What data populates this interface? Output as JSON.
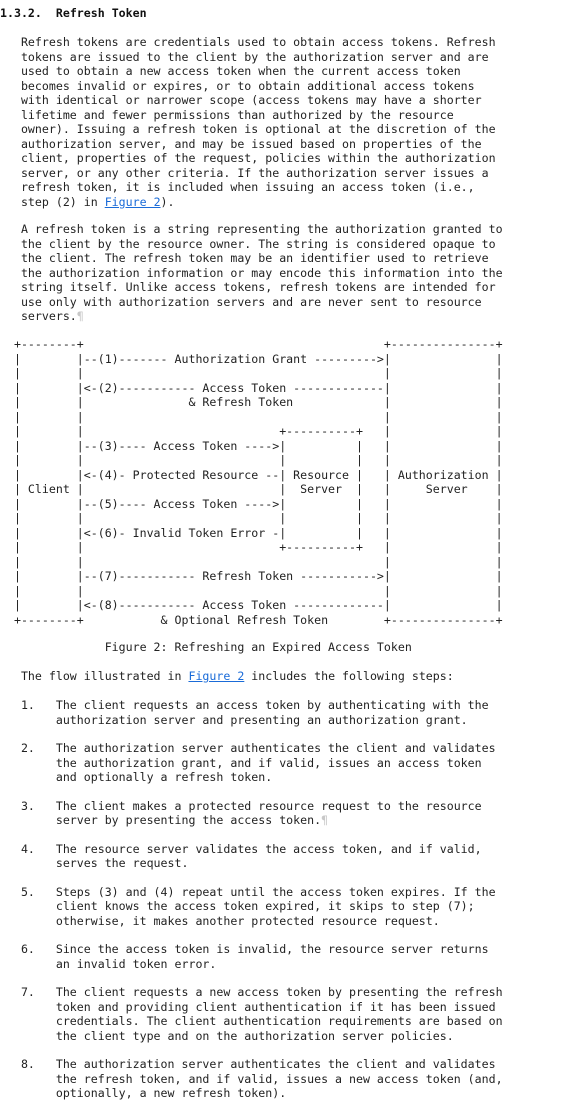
{
  "section": {
    "number": "1.3.2.",
    "title": "Refresh Token"
  },
  "colors": {
    "link": "#1a6bd8",
    "text": "#222222",
    "pilcrow": "#c8c8c8"
  },
  "para1": {
    "l1": "   Refresh tokens are credentials used to obtain access tokens. Refresh",
    "l2": "   tokens are issued to the client by the authorization server and are",
    "l3": "   used to obtain a new access token when the current access token",
    "l4": "   becomes invalid or expires, or to obtain additional access tokens",
    "l5": "   with identical or narrower scope (access tokens may have a shorter",
    "l6": "   lifetime and fewer permissions than authorized by the resource",
    "l7": "   owner). Issuing a refresh token is optional at the discretion of the",
    "l8": "   authorization server, and may be issued based on properties of the",
    "l9": "   client, properties of the request, policies within the authorization",
    "l10": "   server, or any other criteria. If the authorization server issues a",
    "l11": "   refresh token, it is included when issuing an access token (i.e.,",
    "l12_pre": "   step (2) in ",
    "l12_link": "Figure 2",
    "l12_post": ")."
  },
  "para2": {
    "l1": "   A refresh token is a string representing the authorization granted to",
    "l2": "   the client by the resource owner. The string is considered opaque to",
    "l3": "   the client. The refresh token may be an identifier used to retrieve",
    "l4": "   the authorization information or may encode this information into the",
    "l5": "   string itself. Unlike access tokens, refresh tokens are intended for",
    "l6": "   use only with authorization servers and are never sent to resource",
    "l7": "   servers.",
    "pilcrow": "¶"
  },
  "figure": {
    "lines": [
      "  +--------+                                           +---------------+",
      "  |        |--(1)------- Authorization Grant --------->|               |",
      "  |        |                                           |               |",
      "  |        |<-(2)----------- Access Token -------------|               |",
      "  |        |               & Refresh Token             |               |",
      "  |        |                                           |               |",
      "  |        |                            +----------+   |               |",
      "  |        |--(3)---- Access Token ---->|          |   |               |",
      "  |        |                            |          |   |               |",
      "  |        |<-(4)- Protected Resource --| Resource |   | Authorization |",
      "  | Client |                            |  Server  |   |     Server    |",
      "  |        |--(5)---- Access Token ---->|          |   |               |",
      "  |        |                            |          |   |               |",
      "  |        |<-(6)- Invalid Token Error -|          |   |               |",
      "  |        |                            +----------+   |               |",
      "  |        |                                           |               |",
      "  |        |--(7)----------- Refresh Token ----------->|               |",
      "  |        |                                           |               |",
      "  |        |<-(8)----------- Access Token -------------|               |",
      "  +--------+           & Optional Refresh Token        +---------------+"
    ],
    "caption": "               Figure 2: Refreshing an Expired Access Token"
  },
  "flow_intro": {
    "pre": "   The flow illustrated in ",
    "link": "Figure 2",
    "post": " includes the following steps:"
  },
  "steps": {
    "s1": {
      "l1": "   1.   The client requests an access token by authenticating with the",
      "l2": "        authorization server and presenting an authorization grant."
    },
    "s2": {
      "l1": "   2.   The authorization server authenticates the client and validates",
      "l2": "        the authorization grant, and if valid, issues an access token",
      "l3": "        and optionally a refresh token."
    },
    "s3": {
      "l1": "   3.   The client makes a protected resource request to the resource",
      "l2": "        server by presenting the access token.",
      "pilcrow": "¶"
    },
    "s4": {
      "l1": "   4.   The resource server validates the access token, and if valid,",
      "l2": "        serves the request."
    },
    "s5": {
      "l1": "   5.   Steps (3) and (4) repeat until the access token expires. If the",
      "l2": "        client knows the access token expired, it skips to step (7);",
      "l3": "        otherwise, it makes another protected resource request."
    },
    "s6": {
      "l1": "   6.   Since the access token is invalid, the resource server returns",
      "l2": "        an invalid token error."
    },
    "s7": {
      "l1": "   7.   The client requests a new access token by presenting the refresh",
      "l2": "        token and providing client authentication if it has been issued",
      "l3": "        credentials. The client authentication requirements are based on",
      "l4": "        the client type and on the authorization server policies."
    },
    "s8": {
      "l1": "   8.   The authorization server authenticates the client and validates",
      "l2": "        the refresh token, and if valid, issues a new access token (and,",
      "l3": "        optionally, a new refresh token)."
    }
  }
}
